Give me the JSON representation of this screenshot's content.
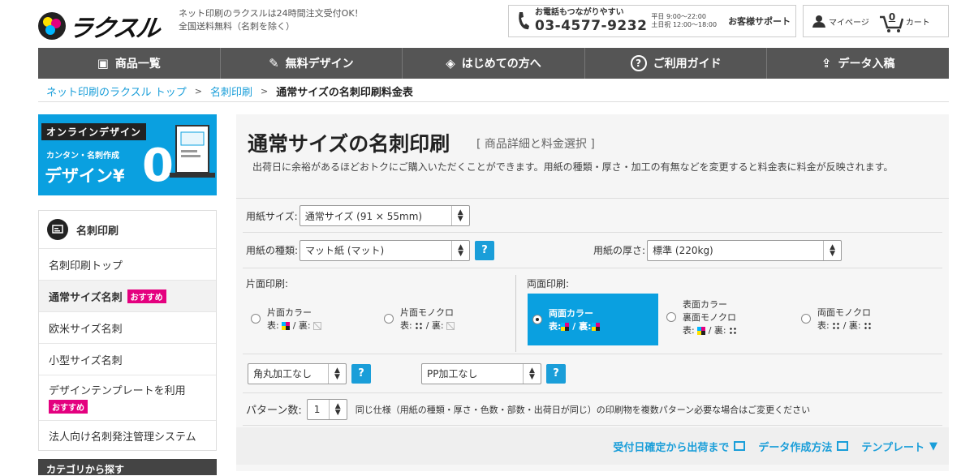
{
  "header": {
    "logo_text": "ラクスル",
    "tagline_line1": "ネット印刷のラクスルは24時間注文受付OK！",
    "tagline_line2": "全国送料無料（名刺を除く）",
    "phone_label": "お電話もつながりやすい",
    "phone_number": "03-4577-9232",
    "hours_weekday": "平日 9:00～22:00",
    "hours_weekend": "土日祝 12:00～18:00",
    "support_label": "お客様サポート",
    "mypage_label": "マイページ",
    "cart_label": "カート",
    "cart_count": "0"
  },
  "nav": {
    "items": [
      {
        "label": "商品一覧",
        "icon": "printer-icon",
        "glyph": "🖶"
      },
      {
        "label": "無料デザイン",
        "icon": "pen-icon",
        "glyph": "✎"
      },
      {
        "label": "はじめての方へ",
        "icon": "beginner-icon",
        "glyph": "◈"
      },
      {
        "label": "ご利用ガイド",
        "icon": "help-icon",
        "glyph": "?"
      },
      {
        "label": "データ入稿",
        "icon": "upload-icon",
        "glyph": "⇪"
      }
    ]
  },
  "breadcrumb": {
    "home": "ネット印刷のラクスル トップ",
    "sep": ">",
    "category": "名刺印刷",
    "current": "通常サイズの名刺印刷料金表"
  },
  "banner": {
    "tag": "オンラインデザイン",
    "sub": "カンタン・名刺作成",
    "main": "デザイン¥",
    "zero": "0"
  },
  "sidebar": {
    "heading": "名刺印刷",
    "items": [
      {
        "label": "名刺印刷トップ",
        "badge": ""
      },
      {
        "label": "通常サイズ名刺",
        "badge": "おすすめ"
      },
      {
        "label": "欧米サイズ名刺",
        "badge": ""
      },
      {
        "label": "小型サイズ名刺",
        "badge": ""
      },
      {
        "label": "デザインテンプレートを利用",
        "badge": "おすすめ"
      },
      {
        "label": "法人向け名刺発注管理システム",
        "badge": ""
      }
    ],
    "section2": "カテゴリから探す"
  },
  "main": {
    "title": "通常サイズの名刺印刷",
    "subtitle": "[ 商品詳細と料金選択 ]",
    "description": "出荷日に余裕があるほどおトクにご購入いただくことができます。用紙の種類・厚さ・加工の有無などを変更すると料金表に料金が反映されます。",
    "paper_size_label": "用紙サイズ:",
    "paper_size_value": "通常サイズ (91 × 55mm)",
    "paper_type_label": "用紙の種類:",
    "paper_type_value": "マット紙 (マット)",
    "paper_thickness_label": "用紙の厚さ:",
    "paper_thickness_value": "標準 (220kg)",
    "single_side_label": "片面印刷:",
    "double_side_label": "両面印刷:",
    "print_options": [
      {
        "line1": "片面カラー",
        "line2_front": "表:",
        "line2_back": "/ 裏:"
      },
      {
        "line1": "片面モノクロ",
        "line2_front": "表:",
        "line2_back": "/ 裏:"
      },
      {
        "line1": "両面カラー",
        "line2_front": "表:",
        "line2_back": "/ 裏:"
      },
      {
        "line1": "表面カラー",
        "line1b": "裏面モノクロ",
        "line2_front": "表:",
        "line2_back": "/ 裏:"
      },
      {
        "line1": "両面モノクロ",
        "line2_front": "表:",
        "line2_back": "/ 裏:"
      }
    ],
    "corner_value": "角丸加工なし",
    "pp_value": "PP加工なし",
    "help_label": "?",
    "pattern_label": "パターン数:",
    "pattern_value": "1",
    "pattern_note": "同じ仕様（用紙の種類・厚さ・色数・部数・出荷日が同じ）の印刷物を複数パターン必要な場合はご変更ください",
    "link_shipping": "受付日確定から出荷まで",
    "link_data": "データ作成方法",
    "link_template": "テンプレート"
  },
  "colors": {
    "accent_blue": "#1a9ed9",
    "nav_bg": "#555555",
    "badge_pink": "#e4007f"
  }
}
